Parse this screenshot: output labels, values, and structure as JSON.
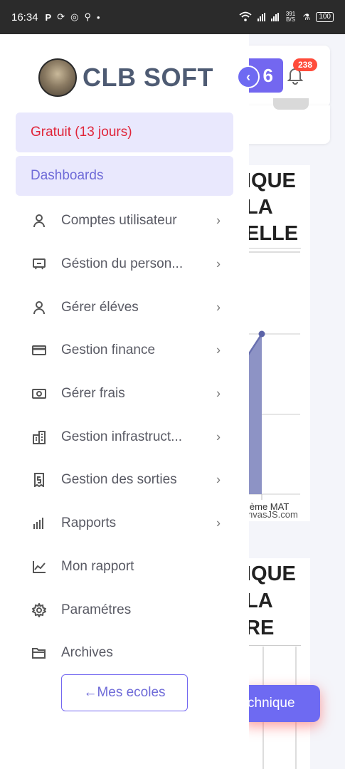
{
  "statusbar": {
    "time": "16:34",
    "left_icons": [
      "P",
      "sync-icon",
      "whatsapp-icon",
      "usb-icon",
      "•"
    ],
    "speed": "391 B/S",
    "battery": "100"
  },
  "brand": {
    "name": "CLB SOFT"
  },
  "trial": {
    "label": "Gratuit (13 jours)"
  },
  "dashboards": {
    "label": "Dashboards"
  },
  "menu": {
    "items": [
      {
        "label": "Comptes utilisateur",
        "icon": "user-icon",
        "chevron": true
      },
      {
        "label": "Géstion du person...",
        "icon": "monitor-icon",
        "chevron": true
      },
      {
        "label": "Gérer éléves",
        "icon": "user-icon",
        "chevron": true
      },
      {
        "label": "Gestion finance",
        "icon": "credit-card-icon",
        "chevron": true
      },
      {
        "label": "Gérer frais",
        "icon": "cash-icon",
        "chevron": true
      },
      {
        "label": "Gestion infrastruct...",
        "icon": "building-icon",
        "chevron": true
      },
      {
        "label": "Gestion des sorties",
        "icon": "receipt-icon",
        "chevron": true
      },
      {
        "label": "Rapports",
        "icon": "bar-chart-icon",
        "chevron": true
      },
      {
        "label": "Mon rapport",
        "icon": "line-chart-icon",
        "chevron": false
      },
      {
        "label": "Paramétres",
        "icon": "gear-icon",
        "chevron": false
      },
      {
        "label": "Archives",
        "icon": "folder-icon",
        "chevron": false
      }
    ]
  },
  "schools_button": {
    "label": "Mes ecoles",
    "arrow": "←"
  },
  "background": {
    "notif_count": "238",
    "top_btn_glyph": "6",
    "chart1_title": [
      "IQUE",
      "LA",
      "ELLE"
    ],
    "chart1_xlabel": "ième MAT",
    "chart1_credit": "nvasJS.com",
    "chart2_title": [
      "IQUE",
      "LA",
      "RE"
    ],
    "fab_label": "chnique"
  },
  "colors": {
    "accent": "#6e6af2",
    "trial_text": "#e0253a",
    "pill_bg": "#e9e8fd",
    "brand_text": "#4e5b73"
  }
}
